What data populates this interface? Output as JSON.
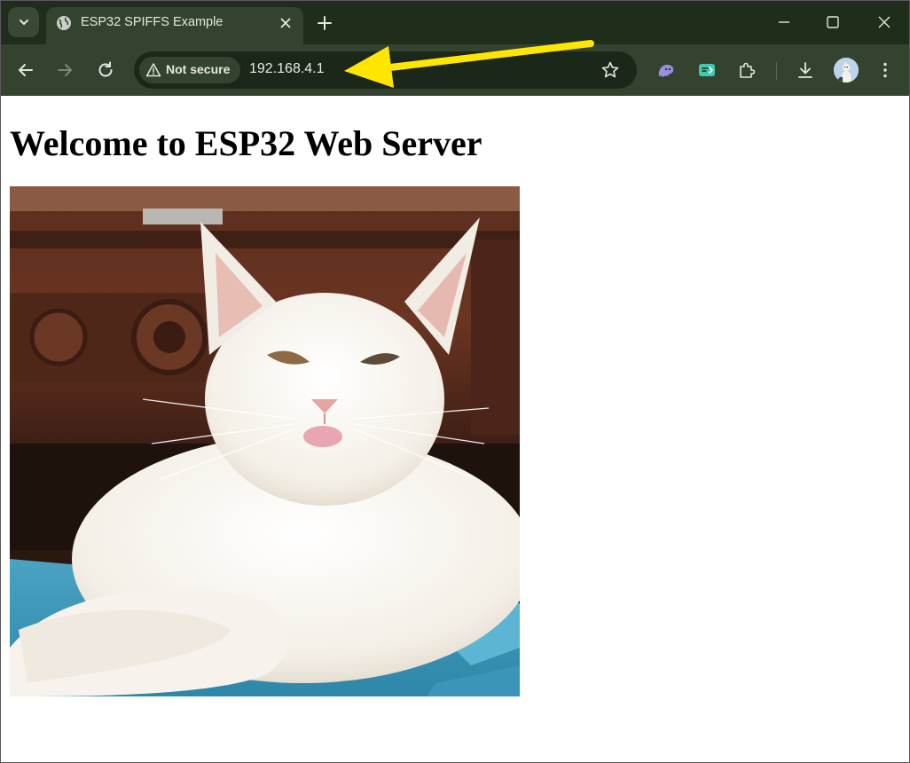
{
  "browser": {
    "tab": {
      "title": "ESP32 SPIFFS Example",
      "favicon": "globe-icon"
    },
    "omnibox": {
      "security_label": "Not secure",
      "url": "192.168.4.1"
    },
    "window_controls": [
      "minimize-icon",
      "maximize-icon",
      "close-icon"
    ],
    "extensions": [
      "ghost-extension-icon",
      "chat-extension-icon",
      "puzzle-extensions-icon"
    ],
    "colors": {
      "frame": "#1f2d1b",
      "toolbar": "#34432f",
      "omnibox": "#1b2719",
      "annotation_arrow": "#ffe600"
    }
  },
  "page": {
    "heading": "Welcome to ESP32 Web Server",
    "image": {
      "subject": "white cat lying on blue foam mat"
    }
  }
}
